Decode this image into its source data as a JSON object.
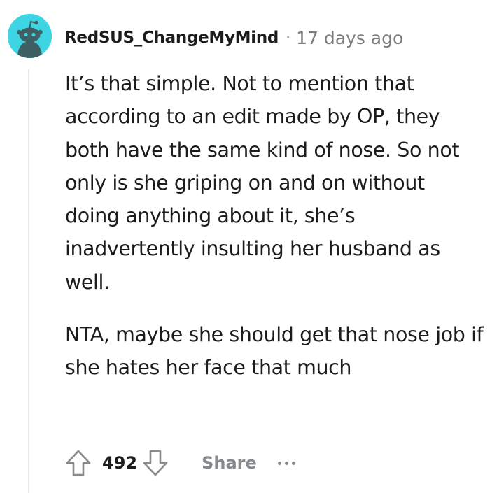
{
  "comment": {
    "username": "RedSUS_ChangeMyMind",
    "separator": "·",
    "timestamp": "17 days ago",
    "avatar_icon": "reddit-snoo-avatar-icon",
    "paragraphs": [
      "It’s that simple. Not to mention that according to an edit made by OP, they both have the same kind of nose. So not only is she griping on and on without doing anything about it, she’s inadvertently insulting her husband as well.",
      "NTA, maybe she should get that nose job if she hates her face that much"
    ],
    "actions": {
      "score": "492",
      "upvote_icon": "upvote-arrow-icon",
      "downvote_icon": "downvote-arrow-icon",
      "share_label": "Share",
      "more_icon": "more-options-icon"
    }
  },
  "colors": {
    "avatar_bg": "#3dd4e3",
    "text": "#1c1c1c",
    "muted": "#878a8c",
    "thread_line": "#e9ebed"
  }
}
